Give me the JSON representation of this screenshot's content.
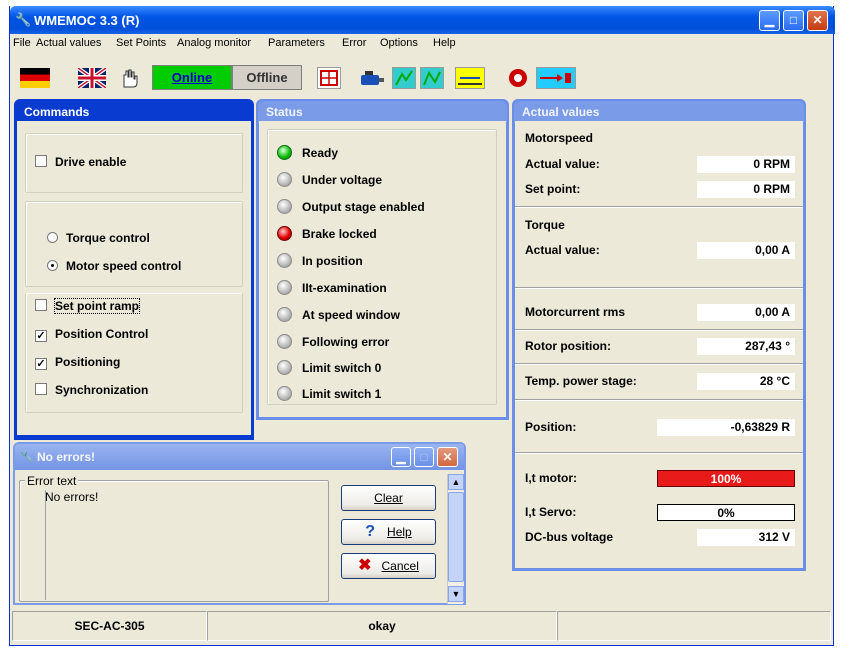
{
  "window": {
    "title": "WMEMOC 3.3 (R)"
  },
  "menu": [
    "File",
    "Actual values",
    "Set Points",
    "Analog monitor",
    "Parameters",
    "Error",
    "Options",
    "Help"
  ],
  "toolbar": {
    "online_label": "Online",
    "offline_label": "Offline"
  },
  "commands": {
    "title": "Commands",
    "drive_enable": {
      "label": "Drive enable",
      "checked": false
    },
    "torque_control": {
      "label": "Torque control",
      "selected": false
    },
    "motor_speed_control": {
      "label": "Motor speed control",
      "selected": true
    },
    "set_point_ramp": {
      "label": "Set point ramp",
      "checked": false
    },
    "position_control": {
      "label": "Position Control",
      "checked": true
    },
    "positioning": {
      "label": "Positioning",
      "checked": true
    },
    "synchronization": {
      "label": "Synchronization",
      "checked": false
    }
  },
  "status": {
    "title": "Status",
    "items": [
      {
        "label": "Ready",
        "state": "green"
      },
      {
        "label": "Under voltage",
        "state": "off"
      },
      {
        "label": "Output stage enabled",
        "state": "off"
      },
      {
        "label": "Brake locked",
        "state": "red"
      },
      {
        "label": "In position",
        "state": "off"
      },
      {
        "label": "IIt-examination",
        "state": "off"
      },
      {
        "label": "At speed window",
        "state": "off"
      },
      {
        "label": "Following error",
        "state": "off"
      },
      {
        "label": "Limit switch 0",
        "state": "off"
      },
      {
        "label": "Limit switch 1",
        "state": "off"
      }
    ]
  },
  "actual_values": {
    "title": "Actual values",
    "motorspeed_header": "Motorspeed",
    "motorspeed_actual_label": "Actual value:",
    "motorspeed_actual_value": "0 RPM",
    "motorspeed_setpoint_label": "Set point:",
    "motorspeed_setpoint_value": "0 RPM",
    "torque_header": "Torque",
    "torque_actual_label": "Actual value:",
    "torque_actual_value": "0,00 A",
    "motorcurrent_label": "Motorcurrent rms",
    "motorcurrent_value": "0,00 A",
    "rotor_position_label": "Rotor position:",
    "rotor_position_value": "287,43 °",
    "temp_label": "Temp. power stage:",
    "temp_value": "28 °C",
    "position_label": "Position:",
    "position_value": "-0,63829  R",
    "i2t_motor_label": "I,t motor:",
    "i2t_motor_value": "100%",
    "i2t_motor_color": "#e81a1a",
    "i2t_servo_label": "I,t Servo:",
    "i2t_servo_value": "0%",
    "dc_bus_label": "DC-bus voltage",
    "dc_bus_value": "312 V"
  },
  "error_dialog": {
    "title": "No errors!",
    "group_label": "Error text",
    "message": "No errors!",
    "clear_label": "Clear",
    "help_label": "Help",
    "cancel_label": "Cancel"
  },
  "statusbar": {
    "device": "SEC-AC-305",
    "state": "okay",
    "extra": ""
  }
}
